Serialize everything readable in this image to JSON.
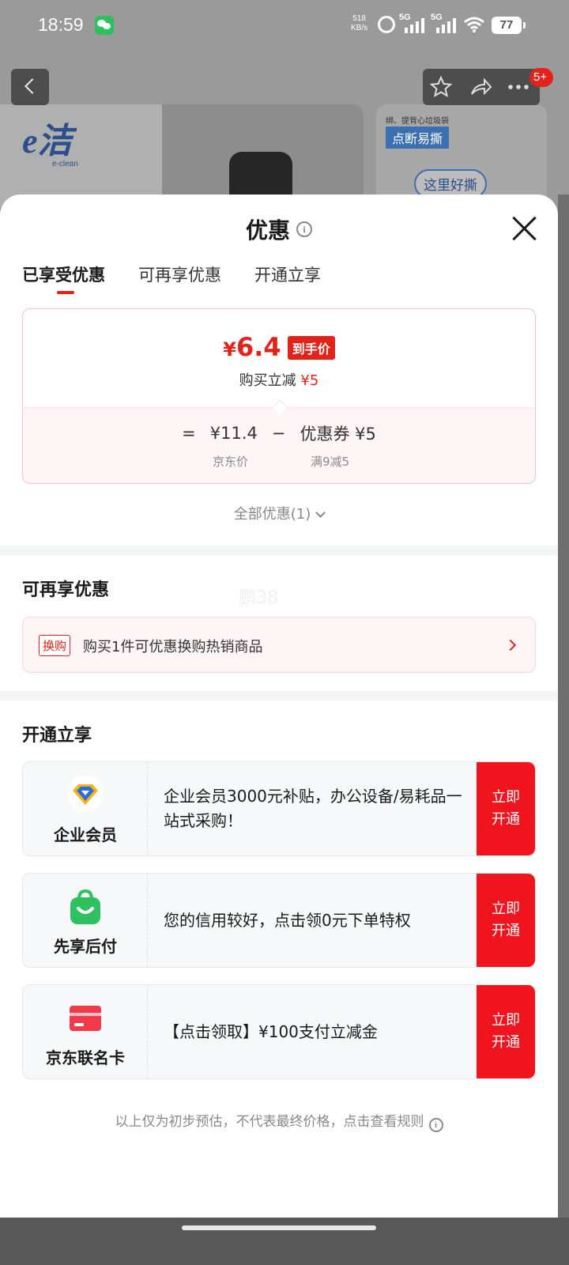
{
  "status_bar": {
    "time": "18:59",
    "net_speed_value": "518",
    "net_speed_unit": "KB/s",
    "signal_1": "5G",
    "signal_2": "5G",
    "battery": "77"
  },
  "background": {
    "brand_logo": "e洁",
    "brand_logo_sub": "e-clean",
    "banner_2_text": "绑、提背心垃圾袋",
    "banner_2_tag": "点断易撕",
    "banner_2_bubble": "这里好撕",
    "more_badge": "5+"
  },
  "sheet": {
    "title": "优惠",
    "tabs": [
      {
        "label": "已享受优惠",
        "active": true
      },
      {
        "label": "可再享优惠",
        "active": false
      },
      {
        "label": "开通立享",
        "active": false
      }
    ],
    "price_card": {
      "final_price_symbol": "¥",
      "final_price": "6.4",
      "final_price_tag": "到手价",
      "instant_label": "购买立减",
      "instant_value": "¥5",
      "equals": "=",
      "jd_price": "¥11.4",
      "minus": "−",
      "coupon": "优惠券 ¥5",
      "jd_price_label": "京东价",
      "coupon_rule": "满9减5"
    },
    "all_discounts": "全部优惠(1)",
    "more_section": {
      "title": "可再享优惠",
      "watermark": "鹏38",
      "swap_tag": "换购",
      "swap_text": "购买1件可优惠换购热销商品"
    },
    "open_section": {
      "title": "开通立享",
      "offers": [
        {
          "name": "企业会员",
          "icon": "enterprise-member-icon",
          "desc": "企业会员3000元补贴，办公设备/易耗品一站式采购！",
          "button": "立即开通"
        },
        {
          "name": "先享后付",
          "icon": "pay-later-bag-icon",
          "desc": "您的信用较好，点击领0元下单特权",
          "button": "立即开通"
        },
        {
          "name": "京东联名卡",
          "icon": "credit-card-icon",
          "desc": "【点击领取】¥100支付立减金",
          "button": "立即开通"
        }
      ]
    },
    "footnote": "以上仅为初步预估，不代表最终价格，点击查看规则"
  },
  "colors": {
    "accent_red": "#e2231a",
    "button_red": "#f0141e",
    "green": "#2ec15f"
  }
}
